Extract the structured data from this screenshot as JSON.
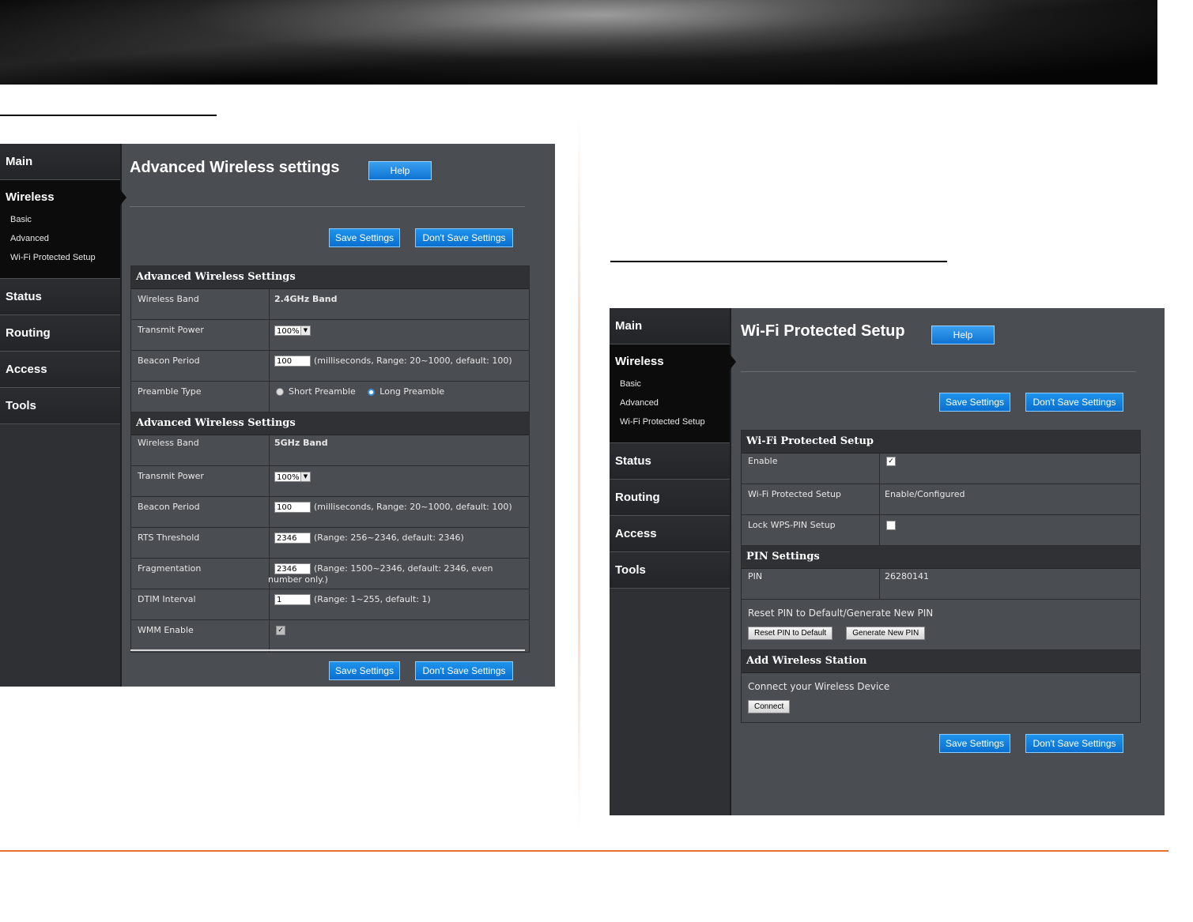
{
  "panel1": {
    "nav": {
      "main": "Main",
      "wireless": "Wireless",
      "sub": [
        "Basic",
        "Advanced",
        "Wi-Fi Protected Setup"
      ],
      "status": "Status",
      "routing": "Routing",
      "access": "Access",
      "tools": "Tools"
    },
    "title": "Advanced Wireless settings",
    "help": "Help",
    "save": "Save Settings",
    "dont_save": "Don't Save Settings",
    "sec1": {
      "header": "Advanced Wireless Settings",
      "band_label": "Wireless Band",
      "band_value": "2.4GHz Band",
      "tx_label": "Transmit Power",
      "tx_value": "100%",
      "beacon_label": "Beacon Period",
      "beacon_value": "100",
      "beacon_hint": "(milliseconds, Range: 20~1000, default: 100)",
      "preamble_label": "Preamble Type",
      "short_preamble": "Short Preamble",
      "long_preamble": "Long Preamble"
    },
    "sec2": {
      "header": "Advanced Wireless Settings",
      "band_label": "Wireless Band",
      "band_value": "5GHz Band",
      "tx_label": "Transmit Power",
      "tx_value": "100%",
      "beacon_label": "Beacon Period",
      "beacon_value": "100",
      "beacon_hint": "(milliseconds, Range: 20~1000, default: 100)",
      "rts_label": "RTS Threshold",
      "rts_value": "2346",
      "rts_hint": "(Range: 256~2346, default: 2346)",
      "frag_label": "Fragmentation",
      "frag_value": "2346",
      "frag_hint_1": "(Range: 1500~2346, default: 2346, even",
      "frag_hint_2": "number only.)",
      "dtim_label": "DTIM Interval",
      "dtim_value": "1",
      "dtim_hint": "(Range: 1~255, default: 1)",
      "wmm_label": "WMM Enable"
    }
  },
  "panel2": {
    "nav": {
      "main": "Main",
      "wireless": "Wireless",
      "sub": [
        "Basic",
        "Advanced",
        "Wi-Fi Protected Setup"
      ],
      "status": "Status",
      "routing": "Routing",
      "access": "Access",
      "tools": "Tools"
    },
    "title": "Wi-Fi Protected Setup",
    "help": "Help",
    "save": "Save Settings",
    "dont_save": "Don't Save Settings",
    "wps": {
      "header": "Wi-Fi Protected Setup",
      "enable_label": "Enable",
      "wps_label": "Wi-Fi Protected Setup",
      "wps_value": "Enable/Configured",
      "lock_label": "Lock WPS-PIN Setup"
    },
    "pin": {
      "header": "PIN Settings",
      "pin_label": "PIN",
      "pin_value": "26280141",
      "reset_text": "Reset PIN to Default/Generate New PIN",
      "reset_btn": "Reset PIN to Default",
      "generate_btn": "Generate New PIN"
    },
    "station": {
      "header": "Add Wireless Station",
      "connect_text": "Connect your Wireless Device",
      "connect_btn": "Connect"
    }
  }
}
